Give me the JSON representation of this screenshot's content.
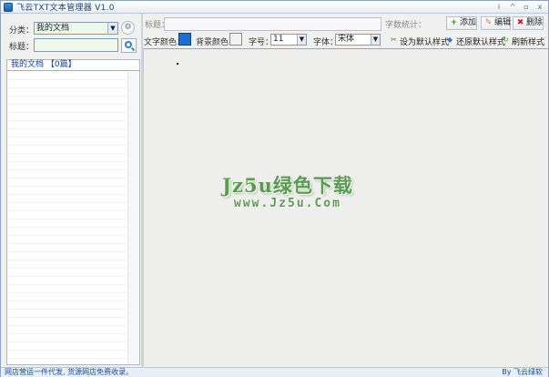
{
  "window": {
    "title": "飞云TXT文本管理器 V1.0",
    "controls": {
      "info": "i",
      "minimize": "^",
      "restore": "▫",
      "close": "x"
    }
  },
  "left": {
    "category_label": "分类：",
    "category_value": "我的文档",
    "title_label": "标题：",
    "title_value": "",
    "list_header": "我的文档 【0篇】",
    "items": []
  },
  "toolbar": {
    "title_label": "标题：",
    "title_value": "",
    "wordcount_label": "字数统计：",
    "add_label": "添加",
    "edit_label": "编辑",
    "delete_label": "删除",
    "text_color_label": "文字颜色：",
    "text_color": "#1c6fd0",
    "bg_color_label": "背景颜色：",
    "bg_color": "#f2f2f0",
    "font_size_label": "字号：",
    "font_size_value": "11",
    "font_label": "字体：",
    "font_value": "宋体",
    "set_default_label": "设为默认样式",
    "restore_default_label": "还原默认样式",
    "refresh_label": "刷新样式"
  },
  "editor": {
    "content": "",
    "watermark_main": "Jz5u绿色下载",
    "watermark_sub": "www.Jz5u.Com"
  },
  "status": {
    "left": "网店营运一件代发, 货源网店免费收录。",
    "right": "By 飞云绿软"
  },
  "icons": {
    "app": "app-icon",
    "gear": "gear-icon",
    "search": "search-icon",
    "add": "plus-icon",
    "edit": "pencil-icon",
    "delete": "x-icon",
    "set_default": "wrench-icon",
    "restore": "diamond-icon",
    "refresh": "refresh-icon"
  }
}
